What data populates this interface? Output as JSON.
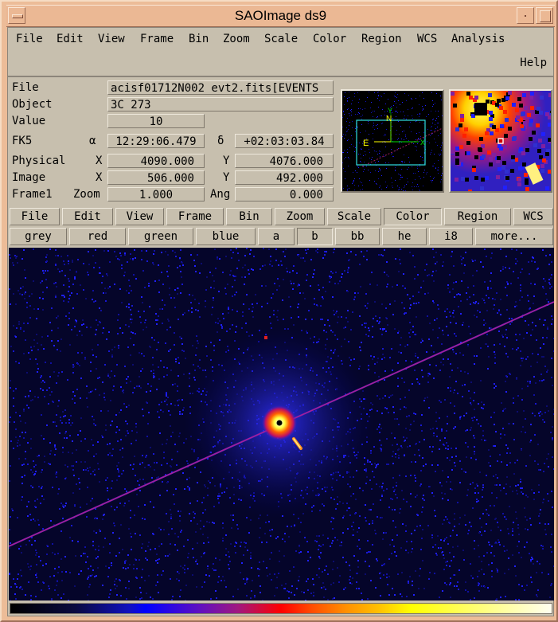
{
  "window": {
    "title": "SAOImage ds9"
  },
  "menubar": {
    "items": [
      "File",
      "Edit",
      "View",
      "Frame",
      "Bin",
      "Zoom",
      "Scale",
      "Color",
      "Region",
      "WCS",
      "Analysis"
    ],
    "help": "Help"
  },
  "info": {
    "file_label": "File",
    "file_value": "acisf01712N002_evt2.fits[EVENTS",
    "object_label": "Object",
    "object_value": "3C 273",
    "value_label": "Value",
    "value_value": "10",
    "fk5_label": "FK5",
    "alpha_symbol": "α",
    "alpha_value": "12:29:06.479",
    "delta_symbol": "δ",
    "delta_value": "+02:03:03.84",
    "physical_label": "Physical",
    "physical_x_label": "X",
    "physical_x": "4090.000",
    "physical_y_label": "Y",
    "physical_y": "4076.000",
    "image_label": "Image",
    "image_x_label": "X",
    "image_x": "506.000",
    "image_y_label": "Y",
    "image_y": "492.000",
    "frame_label": "Frame1",
    "zoom_label": "Zoom",
    "zoom_value": "1.000",
    "ang_label": "Ang",
    "ang_value": "0.000"
  },
  "panner": {
    "compass_n": "N",
    "compass_e": "E",
    "axis_x": "X",
    "axis_y": "Y"
  },
  "buttonbar": {
    "main": [
      "File",
      "Edit",
      "View",
      "Frame",
      "Bin",
      "Zoom",
      "Scale",
      "Color",
      "Region",
      "WCS"
    ],
    "main_active": "Color",
    "colormaps": [
      "grey",
      "red",
      "green",
      "blue",
      "a",
      "b",
      "bb",
      "he",
      "i8",
      "more..."
    ],
    "colormap_active": "b"
  },
  "colorbar": {
    "colormap": "b",
    "stops": [
      "#000000",
      "#0000ff",
      "#ff0000",
      "#ffff00",
      "#ffffff"
    ]
  }
}
